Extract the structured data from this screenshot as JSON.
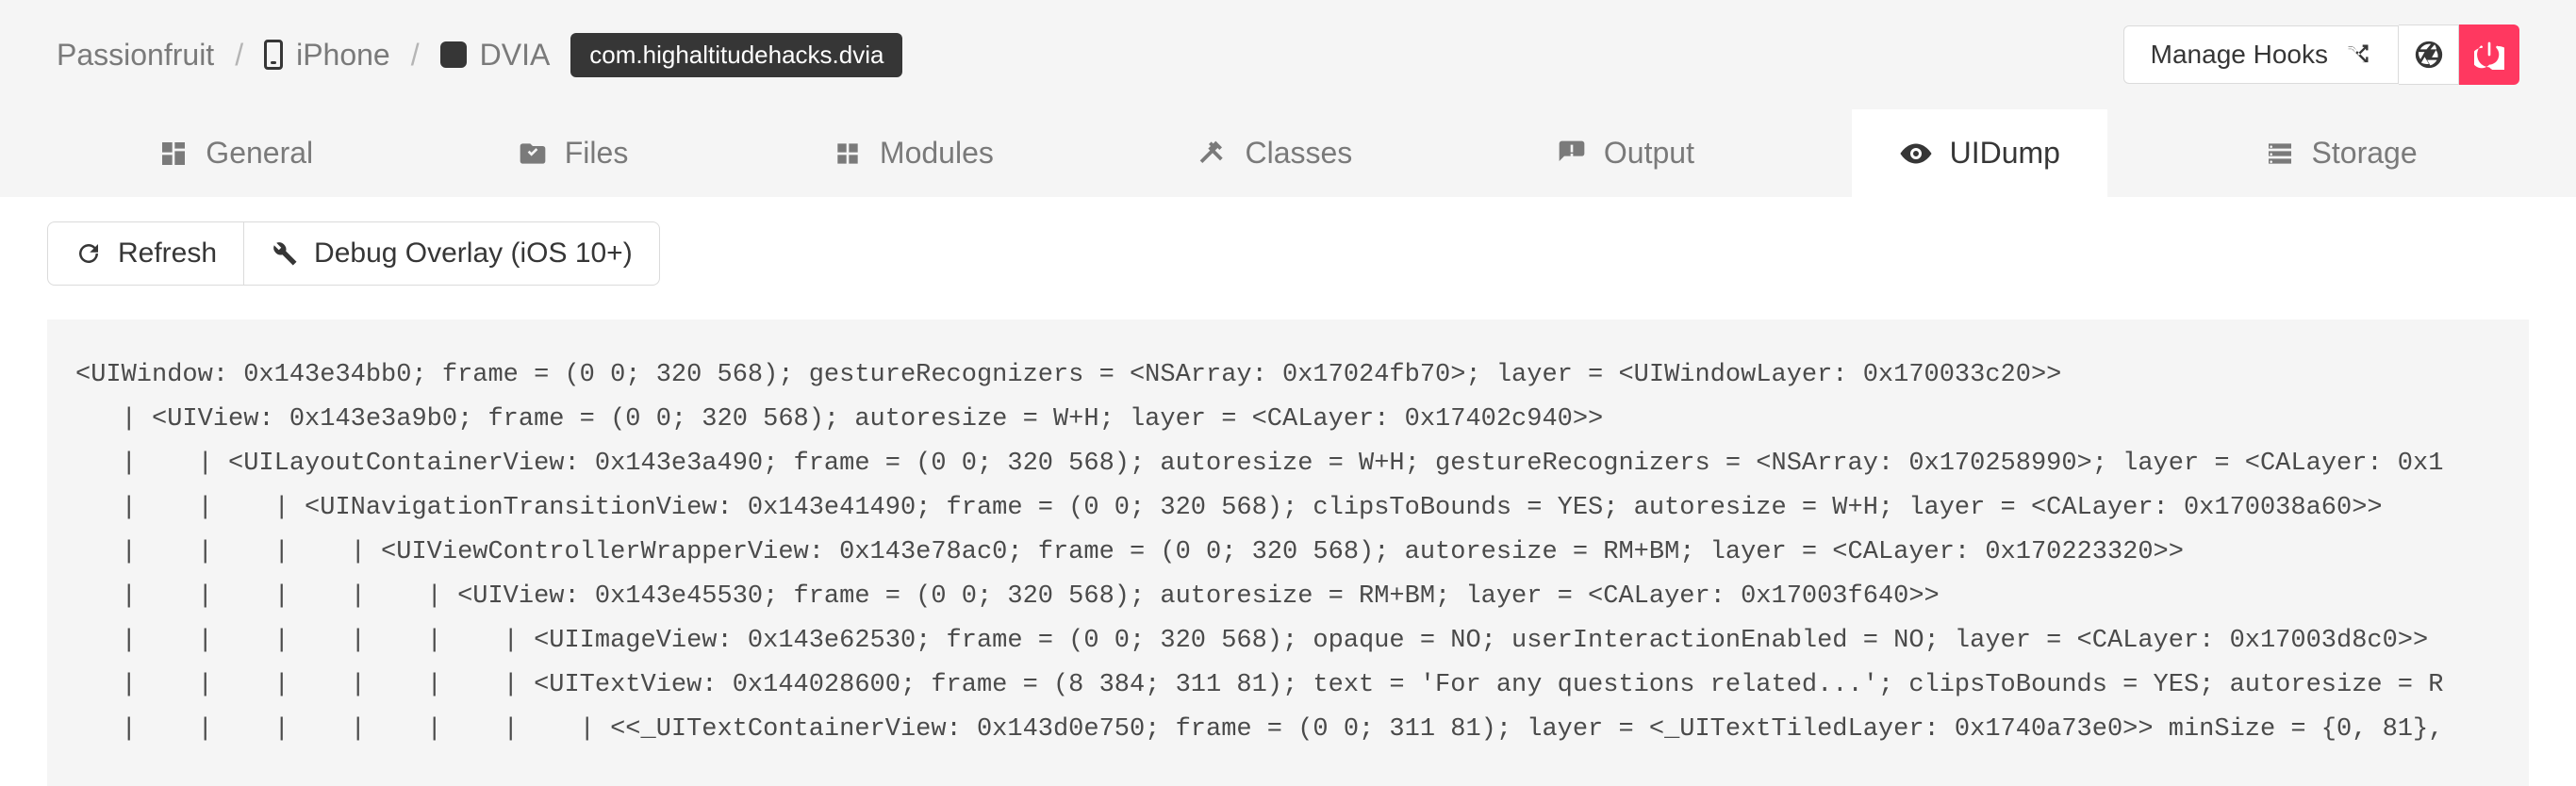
{
  "breadcrumb": {
    "root": "Passionfruit",
    "device": "iPhone",
    "app": "DVIA",
    "bundle": "com.highaltitudehacks.dvia"
  },
  "header": {
    "manage_hooks": "Manage Hooks"
  },
  "tabs": {
    "general": "General",
    "files": "Files",
    "modules": "Modules",
    "classes": "Classes",
    "output": "Output",
    "uidump": "UIDump",
    "storage": "Storage"
  },
  "toolbar": {
    "refresh": "Refresh",
    "debug_overlay": "Debug Overlay (iOS 10+)"
  },
  "dump_lines": [
    "<UIWindow: 0x143e34bb0; frame = (0 0; 320 568); gestureRecognizers = <NSArray: 0x17024fb70>; layer = <UIWindowLayer: 0x170033c20>>",
    "   | <UIView: 0x143e3a9b0; frame = (0 0; 320 568); autoresize = W+H; layer = <CALayer: 0x17402c940>>",
    "   |    | <UILayoutContainerView: 0x143e3a490; frame = (0 0; 320 568); autoresize = W+H; gestureRecognizers = <NSArray: 0x170258990>; layer = <CALayer: 0x1",
    "   |    |    | <UINavigationTransitionView: 0x143e41490; frame = (0 0; 320 568); clipsToBounds = YES; autoresize = W+H; layer = <CALayer: 0x170038a60>>",
    "   |    |    |    | <UIViewControllerWrapperView: 0x143e78ac0; frame = (0 0; 320 568); autoresize = RM+BM; layer = <CALayer: 0x170223320>>",
    "   |    |    |    |    | <UIView: 0x143e45530; frame = (0 0; 320 568); autoresize = RM+BM; layer = <CALayer: 0x17003f640>>",
    "   |    |    |    |    |    | <UIImageView: 0x143e62530; frame = (0 0; 320 568); opaque = NO; userInteractionEnabled = NO; layer = <CALayer: 0x17003d8c0>>",
    "   |    |    |    |    |    | <UITextView: 0x144028600; frame = (8 384; 311 81); text = 'For any questions related...'; clipsToBounds = YES; autoresize = R",
    "   |    |    |    |    |    |    | <<_UITextContainerView: 0x143d0e750; frame = (0 0; 311 81); layer = <_UITextTiledLayer: 0x1740a73e0>> minSize = {0, 81},"
  ]
}
